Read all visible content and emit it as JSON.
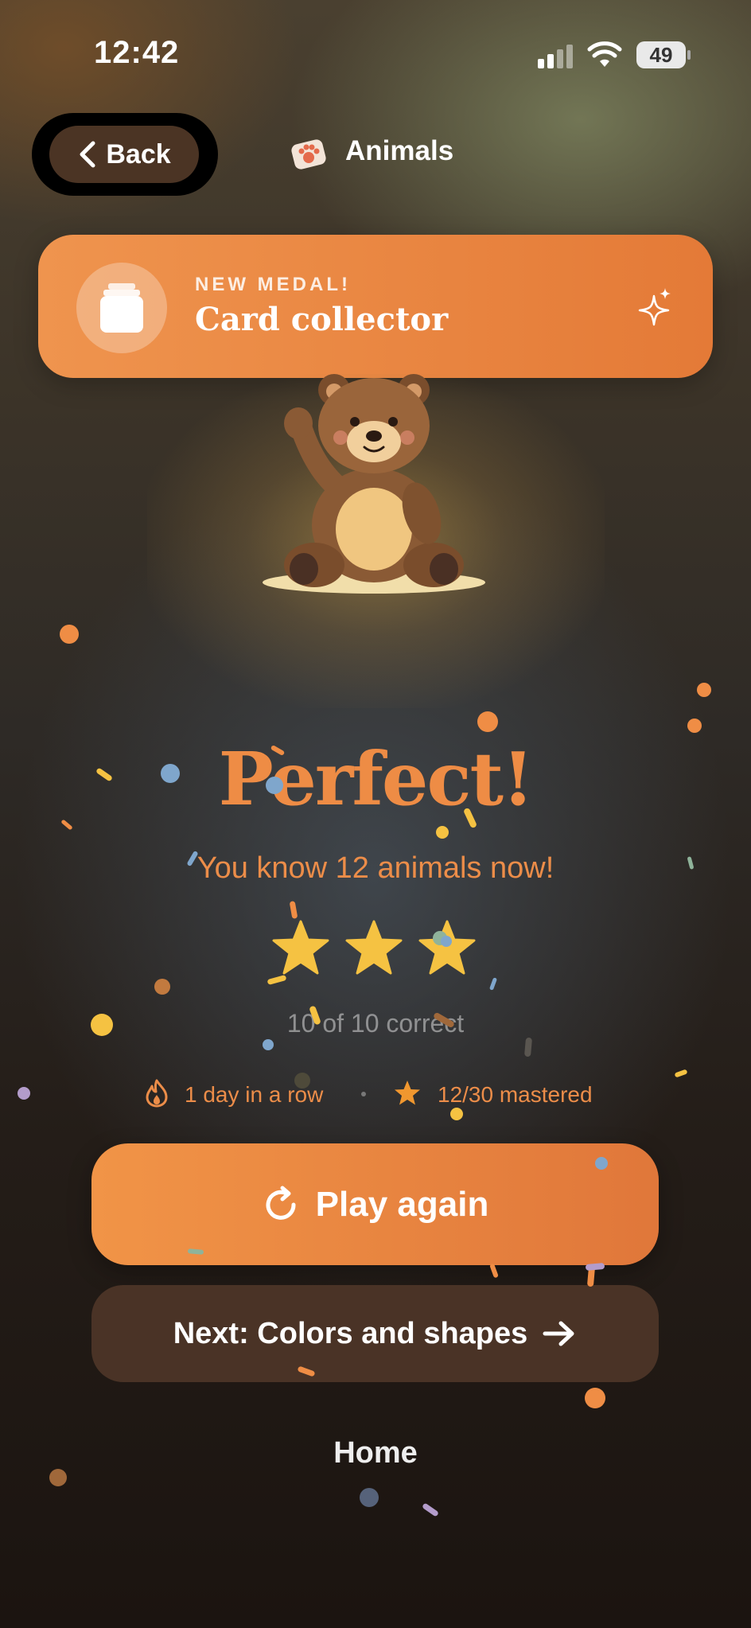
{
  "status_bar": {
    "time": "12:42",
    "battery": "49",
    "icons": [
      "cellular-signal-icon",
      "wifi-icon",
      "battery-icon"
    ]
  },
  "header": {
    "back_label": "Back",
    "back_icon": "chevron-left-icon",
    "category_icon": "paw-print-icon",
    "category_title": "Animals"
  },
  "medal_banner": {
    "kicker": "NEW MEDAL!",
    "title": "Card collector",
    "icon": "card-stack-icon",
    "decoration_icon": "sparkle-icon"
  },
  "hero": {
    "image": "waving-teddy-bear-illustration"
  },
  "result": {
    "headline": "Perfect!",
    "subtitle": "You know 12 animals now!",
    "stars_earned": 3,
    "stars_total": 3,
    "score_text": "10 of 10 correct"
  },
  "stats": {
    "streak_icon": "flame-icon",
    "streak_text": "1 day in a row",
    "mastered_icon": "star-icon",
    "mastered_text": "12/30 mastered"
  },
  "actions": {
    "play_again_label": "Play again",
    "play_again_icon": "refresh-icon",
    "next_label": "Next: Colors and shapes",
    "next_icon": "arrow-right-icon",
    "home_label": "Home"
  },
  "colors": {
    "accent_orange": "#ee8c45",
    "star_yellow": "#f5c242",
    "button_brown": "#4a3326",
    "back_button_brown": "#4b3424"
  }
}
